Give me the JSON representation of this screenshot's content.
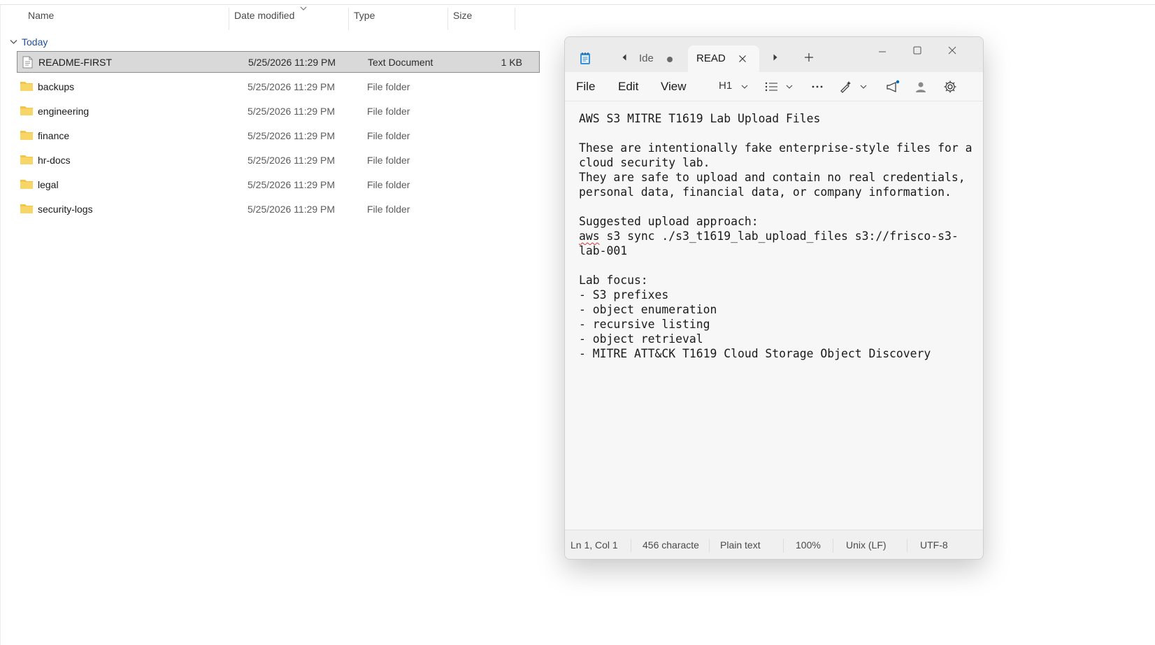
{
  "explorer": {
    "columns": {
      "name": "Name",
      "date": "Date modified",
      "type": "Type",
      "size": "Size"
    },
    "group": "Today",
    "files": [
      {
        "name": "README-FIRST",
        "date": "5/25/2026 11:29 PM",
        "type": "Text Document",
        "size": "1 KB",
        "icon": "text-document-icon",
        "selected": true
      },
      {
        "name": "backups",
        "date": "5/25/2026 11:29 PM",
        "type": "File folder",
        "size": "",
        "icon": "folder-icon"
      },
      {
        "name": "engineering",
        "date": "5/25/2026 11:29 PM",
        "type": "File folder",
        "size": "",
        "icon": "folder-icon"
      },
      {
        "name": "finance",
        "date": "5/25/2026 11:29 PM",
        "type": "File folder",
        "size": "",
        "icon": "folder-icon"
      },
      {
        "name": "hr-docs",
        "date": "5/25/2026 11:29 PM",
        "type": "File folder",
        "size": "",
        "icon": "folder-icon"
      },
      {
        "name": "legal",
        "date": "5/25/2026 11:29 PM",
        "type": "File folder",
        "size": "",
        "icon": "folder-icon"
      },
      {
        "name": "security-logs",
        "date": "5/25/2026 11:29 PM",
        "type": "File folder",
        "size": "",
        "icon": "folder-icon"
      }
    ],
    "colors": {
      "folder": "#f4c542",
      "selection": "#d9d9d9",
      "group_text": "#1f4e9e"
    }
  },
  "notepad": {
    "tabs": {
      "inactive_label": "Ide",
      "active_label": "READ"
    },
    "menu": {
      "file": "File",
      "edit": "Edit",
      "view": "View",
      "heading": "H1"
    },
    "text_lines": [
      "AWS S3 MITRE T1619 Lab Upload Files",
      "",
      "These are intentionally fake enterprise-style files for a",
      "cloud security lab.",
      "They are safe to upload and contain no real credentials,",
      "personal data, financial data, or company information.",
      "",
      "Suggested upload approach:",
      "aws s3 sync ./s3_t1619_lab_upload_files s3://frisco-s3-",
      "lab-001",
      "",
      "Lab focus:",
      "- S3 prefixes",
      "- object enumeration",
      "- recursive listing",
      "- object retrieval",
      "- MITRE ATT&CK T1619 Cloud Storage Object Discovery"
    ],
    "status": {
      "position": "Ln 1, Col 1",
      "characters": "456 characte",
      "format": "Plain text",
      "zoom": "100%",
      "line_ending": "Unix (LF)",
      "encoding": "UTF-8"
    },
    "colors": {
      "accent": "#0067c0",
      "spell_error": "#d33333"
    }
  }
}
